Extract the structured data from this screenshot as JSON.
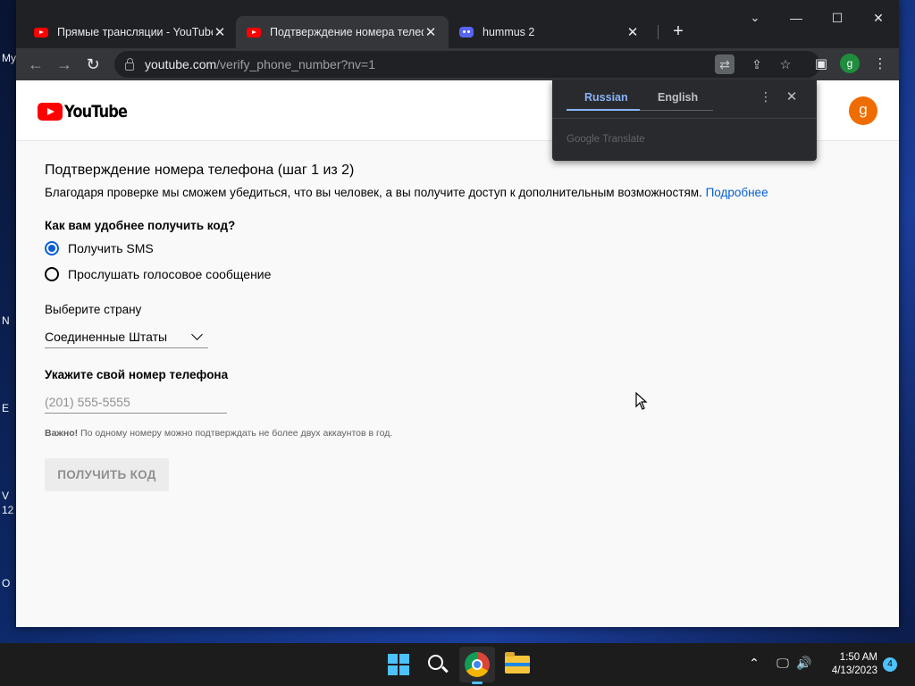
{
  "desktop": {
    "fragments": [
      "My",
      "N",
      "E",
      "V",
      "12",
      "O"
    ]
  },
  "browser": {
    "tabs": [
      {
        "title": "Прямые трансляции - YouTube",
        "favicon": "youtube-icon"
      },
      {
        "title": "Подтверждение номера телефона",
        "favicon": "youtube-icon"
      },
      {
        "title": "hummus 2",
        "favicon": "discord-icon"
      }
    ],
    "url_host": "youtube.com",
    "url_path": "/verify_phone_number?nv=1",
    "profile_initial": "g"
  },
  "translate_popup": {
    "source_lang": "Russian",
    "target_lang": "English",
    "brand": "Google Translate"
  },
  "page": {
    "logo_text": "YouTube",
    "avatar_initial": "g",
    "title": "Подтверждение номера телефона (шаг 1 из 2)",
    "description": "Благодаря проверке мы сможем убедиться, что вы человек, а вы получите доступ к дополнительным возможностям.",
    "learn_more": "Подробнее",
    "method_question": "Как вам удобнее получить код?",
    "method_options": [
      "Получить SMS",
      "Прослушать голосовое сообщение"
    ],
    "selected_method": "Получить SMS",
    "country_label": "Выберите страну",
    "country_value": "Соединенные Штаты",
    "phone_label": "Укажите свой номер телефона",
    "phone_placeholder": "(201) 555-5555",
    "note_bold": "Важно!",
    "note_text": "По одному номеру можно подтверждать не более двух аккаунтов в год.",
    "submit_label": "ПОЛУЧИТЬ КОД"
  },
  "taskbar": {
    "time": "1:50 AM",
    "date": "4/13/2023",
    "notification_count": "4"
  },
  "colors": {
    "youtube_red": "#ff0000",
    "link_blue": "#065fd4",
    "avatar_orange": "#ef6c00",
    "translate_accent": "#8ab4f8"
  }
}
